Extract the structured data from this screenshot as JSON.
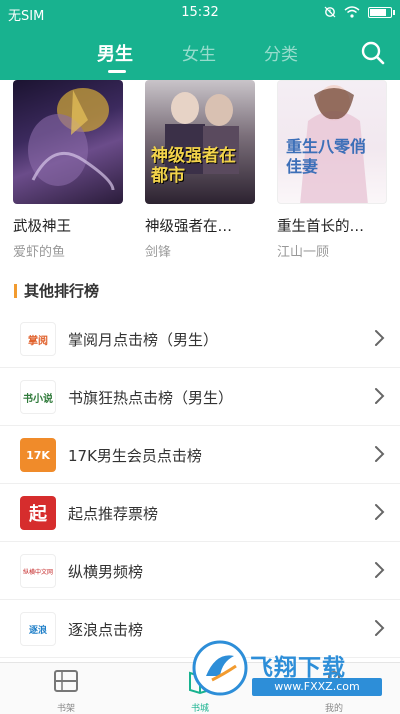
{
  "status_bar": {
    "carrier": "无SIM",
    "time": "15:32",
    "battery_level": 0.85
  },
  "header": {
    "tabs": [
      {
        "label": "男生",
        "active": true
      },
      {
        "label": "女生",
        "active": false
      },
      {
        "label": "分类",
        "active": false
      }
    ],
    "search_icon": "search-icon"
  },
  "books": [
    {
      "title": "武极神王",
      "author": "爱虾的鱼",
      "cover_text": ""
    },
    {
      "title": "神级强者在…",
      "author": "剑锋",
      "cover_text": "神级强者在都市"
    },
    {
      "title": "重生首长的…",
      "author": "江山一顾",
      "cover_text": "重生八零俏佳妻"
    }
  ],
  "section": {
    "title": "其他排行榜"
  },
  "rankings": [
    {
      "label": "掌阅月点击榜（男生）",
      "logo_text": "掌阅"
    },
    {
      "label": "书旗狂热点击榜（男生）",
      "logo_text": "书小说"
    },
    {
      "label": "17K男生会员点击榜",
      "logo_text": "17K"
    },
    {
      "label": "起点推荐票榜",
      "logo_text": "起"
    },
    {
      "label": "纵横男频榜",
      "logo_text": "纵横中文网"
    },
    {
      "label": "逐浪点击榜",
      "logo_text": "逐浪"
    }
  ],
  "bottom_nav": [
    {
      "label": "书架",
      "icon": "bookshelf-icon",
      "active": false
    },
    {
      "label": "书城",
      "icon": "bookstore-icon",
      "active": true
    },
    {
      "label": "我的",
      "icon": "profile-icon",
      "active": false
    }
  ],
  "watermark": {
    "text": "飞翔下载",
    "url": "www.FXXZ.com"
  },
  "colors": {
    "brand": "#18b28f",
    "section_accent": "#f29b2f"
  }
}
